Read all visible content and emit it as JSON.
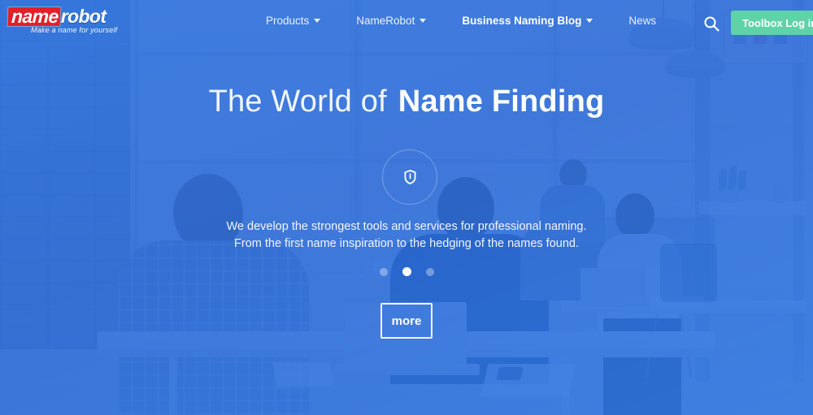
{
  "brand": {
    "logo_name": "name",
    "logo_robot": "robot",
    "tagline": "Make a name for yourself",
    "logo_red": "#e02128"
  },
  "header": {
    "nav": [
      {
        "label": "Products",
        "has_caret": true,
        "active": false
      },
      {
        "label": "NameRobot",
        "has_caret": true,
        "active": false
      },
      {
        "label": "Business Naming Blog",
        "has_caret": true,
        "active": true
      },
      {
        "label": "News",
        "has_caret": false,
        "active": false
      }
    ],
    "search_icon": "search-icon",
    "login_label": "Toolbox Log in",
    "login_color": "#5fd3a8"
  },
  "hero": {
    "title_light": "The World of",
    "title_bold": "Name Finding",
    "badge_icon": "shield-icon",
    "subtitle_line1": "We develop the strongest tools and services for professional naming.",
    "subtitle_line2": "From the first name inspiration to the hedging of the names found.",
    "carousel": {
      "count": 3,
      "active_index": 1
    },
    "more_label": "more",
    "overlay_color": "#2f73e0"
  }
}
